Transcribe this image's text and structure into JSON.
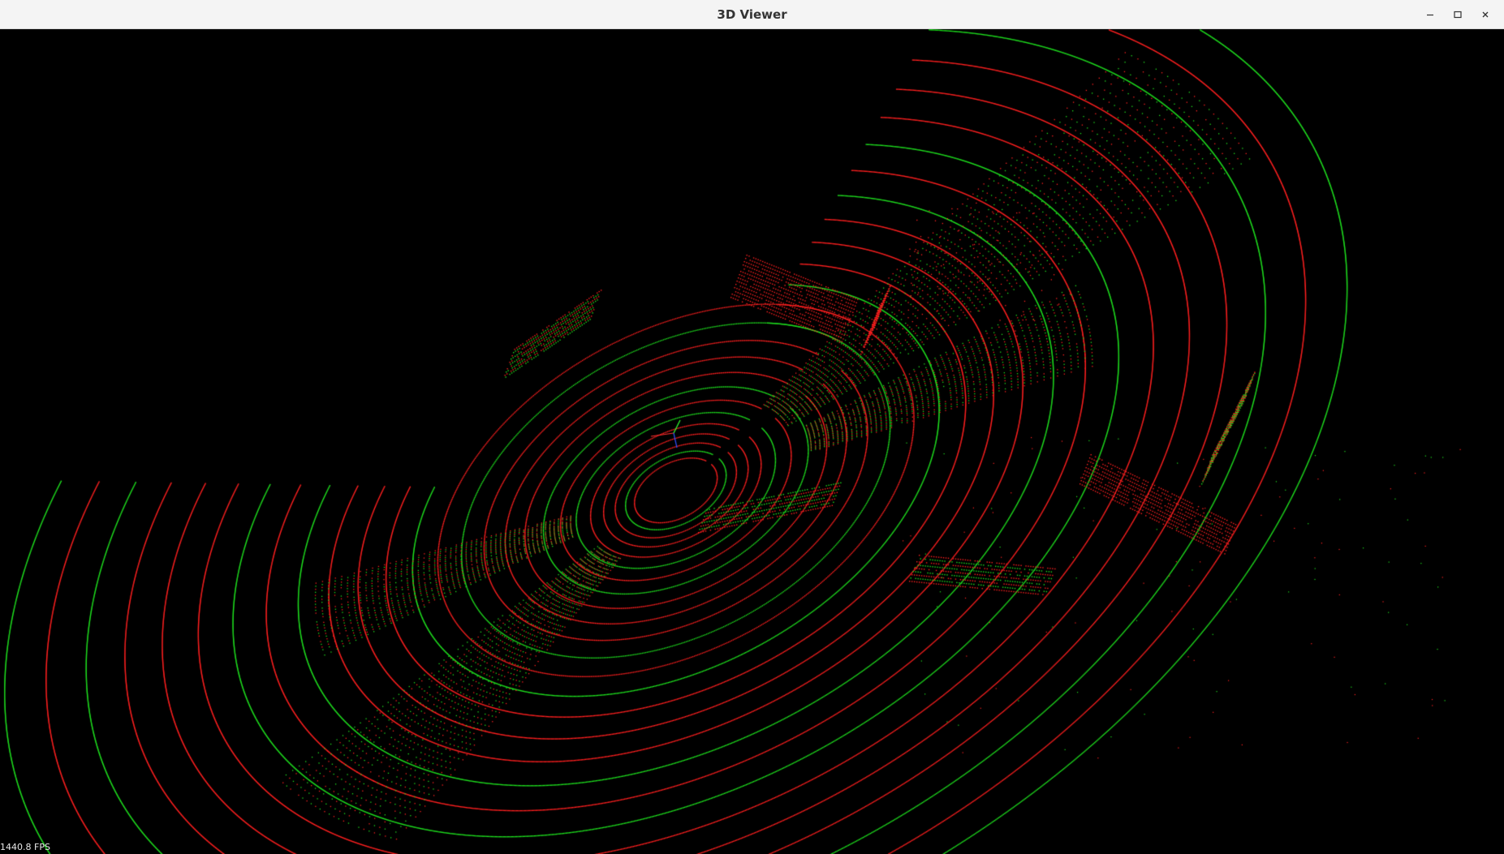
{
  "window": {
    "title": "3D Viewer",
    "controls": {
      "minimize_icon": "minimize-icon",
      "maximize_icon": "maximize-icon",
      "close_icon": "close-icon"
    }
  },
  "viewer": {
    "background": "#000000",
    "point_colors": {
      "primary": "#ff2020",
      "secondary": "#1fe01f"
    },
    "axes_colors": {
      "x": "#ff3030",
      "y": "#30ff30",
      "z": "#3050ff"
    },
    "fps_label": "1440.8 FPS"
  }
}
